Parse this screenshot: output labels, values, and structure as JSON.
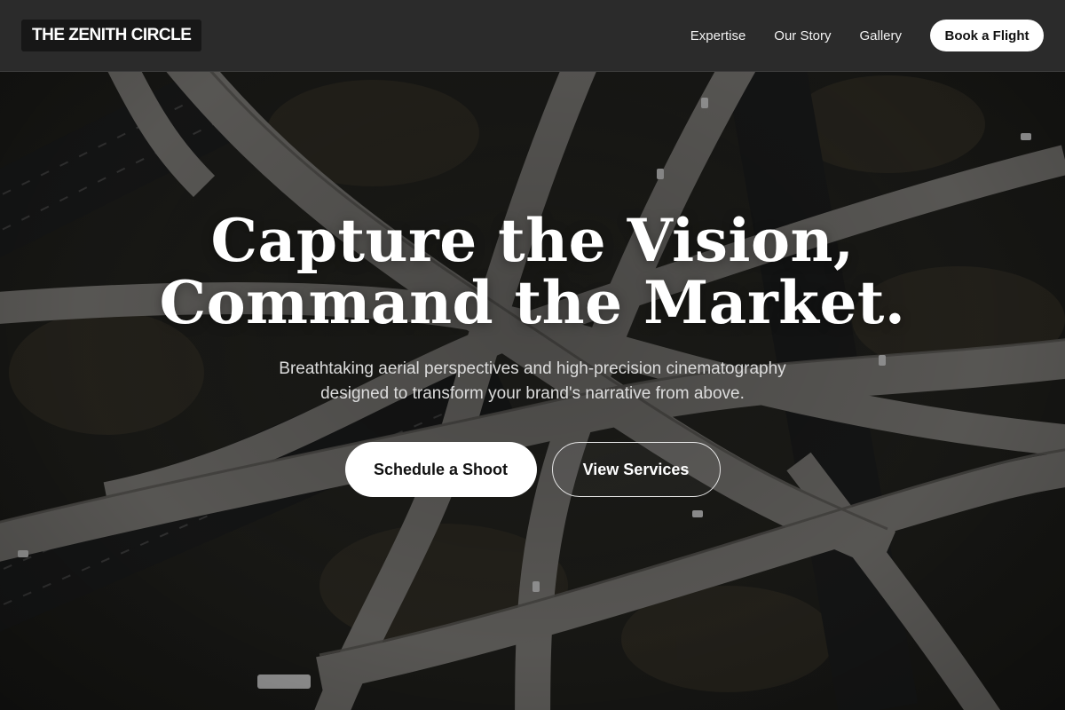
{
  "header": {
    "logo": "THE ZENITH CIRCLE",
    "nav": [
      {
        "label": "Expertise"
      },
      {
        "label": "Our Story"
      },
      {
        "label": "Gallery"
      }
    ],
    "cta_label": "Book a Flight"
  },
  "hero": {
    "title_line1": "Capture the Vision,",
    "title_line2": "Command the Market.",
    "subtitle_line1": "Breathtaking aerial perspectives and high-precision cinematography",
    "subtitle_line2": "designed to transform your brand's narrative from above.",
    "primary_button": "Schedule a Shoot",
    "secondary_button": "View Services"
  },
  "colors": {
    "header_bg": "#2b2b2b",
    "logo_bg": "#171717",
    "text_primary": "#ffffff",
    "button_bg": "#ffffff",
    "button_text": "#111111"
  }
}
